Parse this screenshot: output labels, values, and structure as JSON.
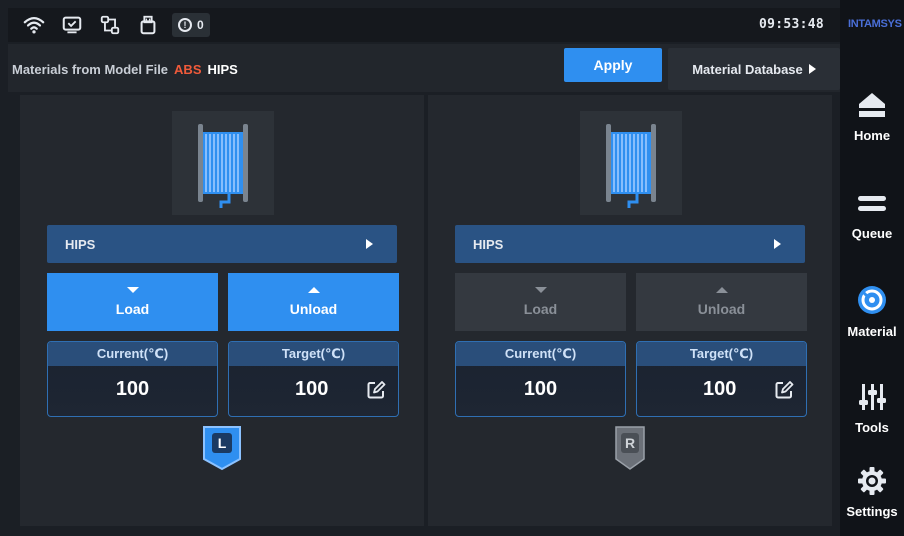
{
  "status_bar": {
    "icons": [
      "wifi-icon",
      "monitor-icon",
      "network-icon",
      "usb-icon"
    ],
    "alert_count": "0",
    "time": "09:53:48"
  },
  "header": {
    "materials_label": "Materials from Model File",
    "material_1": "ABS",
    "material_2": "HIPS",
    "apply_label": "Apply",
    "database_label": "Material Database"
  },
  "panels": {
    "left": {
      "material": "HIPS",
      "load_label": "Load",
      "unload_label": "Unload",
      "current_label": "Current(℃)",
      "target_label": "Target(℃)",
      "current_value": "100",
      "target_value": "100",
      "head_letter": "L",
      "enabled": true
    },
    "right": {
      "material": "HIPS",
      "load_label": "Load",
      "unload_label": "Unload",
      "current_label": "Current(℃)",
      "target_label": "Target(℃)",
      "current_value": "100",
      "target_value": "100",
      "head_letter": "R",
      "enabled": false
    }
  },
  "sidenav": {
    "brand": "INTAMSYS",
    "items": [
      {
        "label": "Home",
        "icon": "home-icon"
      },
      {
        "label": "Queue",
        "icon": "queue-icon"
      },
      {
        "label": "Material",
        "icon": "material-icon",
        "active": true
      },
      {
        "label": "Tools",
        "icon": "tools-icon"
      },
      {
        "label": "Settings",
        "icon": "settings-icon"
      }
    ]
  },
  "colors": {
    "accent": "#2f8ff0",
    "abs_text": "#f05a3a",
    "select_bg": "#2a5384",
    "active_nav": "#2f8ff0"
  }
}
